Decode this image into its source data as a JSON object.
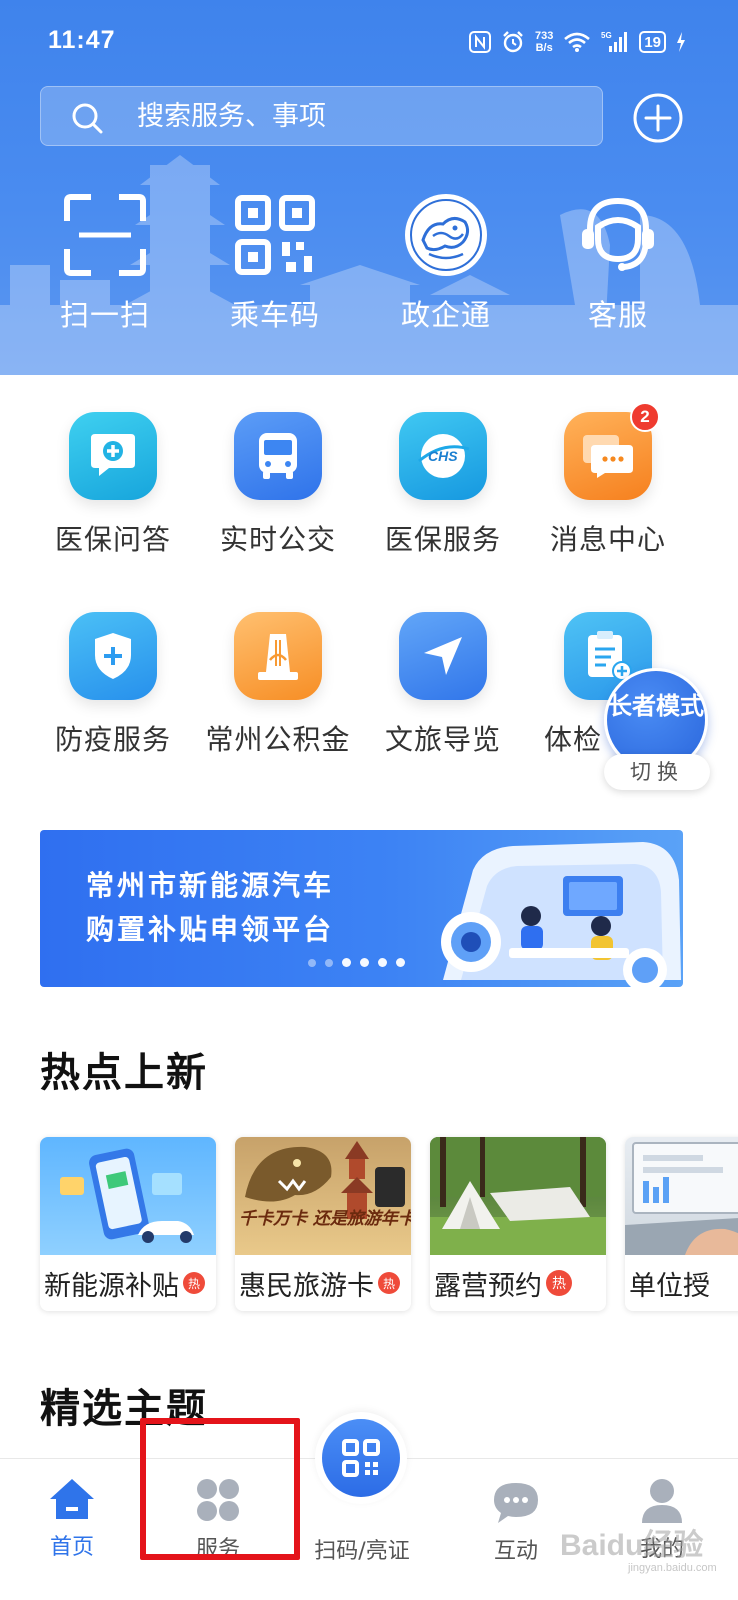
{
  "status_bar": {
    "time": "11:47",
    "net_speed_value": "733",
    "net_speed_unit": "B/s",
    "battery": "19",
    "icons": [
      "nfc-icon",
      "alarm-icon",
      "wifi-icon",
      "5g-signal-icon",
      "battery-icon",
      "charging-icon"
    ]
  },
  "search": {
    "placeholder": "搜索服务、事项"
  },
  "header_actions": [
    "add-icon"
  ],
  "quick_actions": [
    {
      "label": "扫一扫",
      "icon": "scan-icon"
    },
    {
      "label": "乘车码",
      "icon": "qr-code-icon"
    },
    {
      "label": "政企通",
      "icon": "dragon-emblem-icon"
    },
    {
      "label": "客服",
      "icon": "customer-service-icon"
    }
  ],
  "services": [
    {
      "label": "医保问答",
      "icon": "medical-qa-icon",
      "color": "#21b5e3"
    },
    {
      "label": "实时公交",
      "icon": "bus-icon",
      "color": "#3d86f2"
    },
    {
      "label": "医保服务",
      "icon": "chs-icon",
      "color": "#1ea8e8"
    },
    {
      "label": "消息中心",
      "icon": "message-icon",
      "color": "#fb8f2e",
      "badge": "2"
    },
    {
      "label": "防疫服务",
      "icon": "shield-plus-icon",
      "color": "#2d9cf0"
    },
    {
      "label": "常州公积金",
      "icon": "fund-icon",
      "color": "#fb9d3a"
    },
    {
      "label": "文旅导览",
      "icon": "navigation-icon",
      "color": "#3c84f3"
    },
    {
      "label": "体检",
      "icon": "checkup-icon",
      "color": "#2aa6ef"
    }
  ],
  "elder_mode": {
    "title": "长者模式",
    "switch": "切换"
  },
  "banner": {
    "line1": "常州市新能源汽车",
    "line2": "购置补贴申领平台",
    "slides": 6,
    "active_slide": 2
  },
  "hot_section": {
    "title": "热点上新",
    "hot_badge": "热",
    "items": [
      {
        "label": "新能源补贴",
        "hot": true
      },
      {
        "label": "惠民旅游卡",
        "hot": true,
        "image_text": "千卡万卡 还是旅游年卡"
      },
      {
        "label": "露营预约",
        "hot": true
      },
      {
        "label": "单位授",
        "hot": false
      }
    ]
  },
  "featured_section": {
    "title": "精选主题"
  },
  "tabbar": [
    {
      "label": "首页",
      "icon": "home-icon",
      "active": true
    },
    {
      "label": "服务",
      "icon": "services-grid-icon",
      "active": false
    },
    {
      "label": "扫码/亮证",
      "icon": "scan-qr-icon",
      "active": false
    },
    {
      "label": "互动",
      "icon": "chat-bubble-icon",
      "active": false
    },
    {
      "label": "我的",
      "icon": "profile-icon",
      "active": false
    }
  ],
  "colors": {
    "brand_blue": "#3f83ec",
    "tab_active": "#2f74ea",
    "annotation_red": "#e4141a"
  },
  "watermark": {
    "text": "Baidu经验",
    "sub": "jingyan.baidu.com"
  }
}
